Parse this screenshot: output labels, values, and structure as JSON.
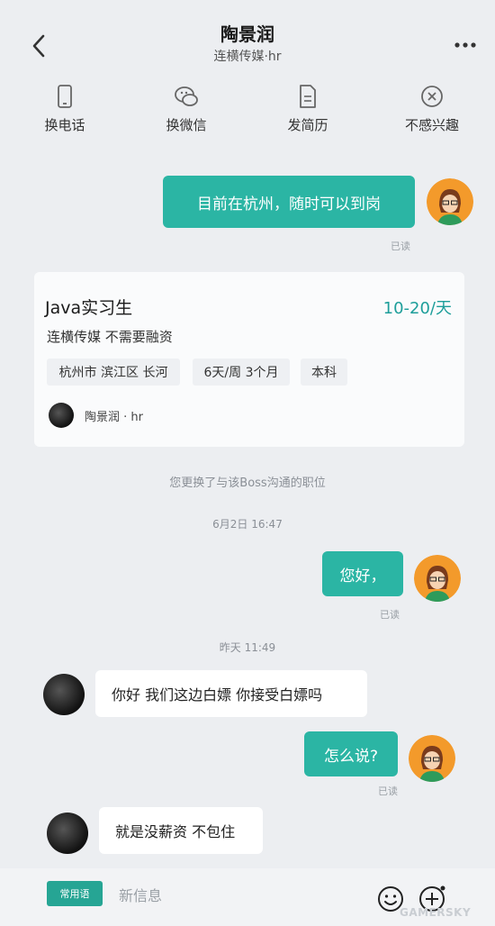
{
  "header": {
    "title": "陶景润",
    "subtitle": "连横传媒·hr"
  },
  "actions": [
    {
      "label": "换电话",
      "icon": "phone-icon"
    },
    {
      "label": "换微信",
      "icon": "wechat-icon"
    },
    {
      "label": "发简历",
      "icon": "resume-icon"
    },
    {
      "label": "不感兴趣",
      "icon": "not-interested-icon"
    }
  ],
  "messages": {
    "m1": {
      "text": "目前在杭州，随时可以到岗",
      "status": "已读"
    },
    "m2": {
      "text": "您好，",
      "status": "已读"
    },
    "m3": {
      "text": "你好 我们这边白嫖 你接受白嫖吗"
    },
    "m4": {
      "text": "怎么说?",
      "status": "已读"
    },
    "m5": {
      "text": "就是没薪资 不包住"
    }
  },
  "job_card": {
    "title": "Java实习生",
    "salary": "10-20/天",
    "company": "连横传媒 不需要融资",
    "tags": [
      "杭州市 滨江区 长河",
      "6天/周 3个月",
      "本科"
    ],
    "hr": "陶景润 · hr"
  },
  "system_notice": "您更换了与该Boss沟通的职位",
  "timestamps": {
    "t1": "6月2日 16:47",
    "t2": "昨天 11:49"
  },
  "input": {
    "quick_label": "常用语",
    "placeholder": "新信息"
  },
  "watermark": "GAMERSKY",
  "colors": {
    "accent": "#2bb5a4",
    "salary": "#1d9e9a",
    "background": "#eceef1"
  }
}
